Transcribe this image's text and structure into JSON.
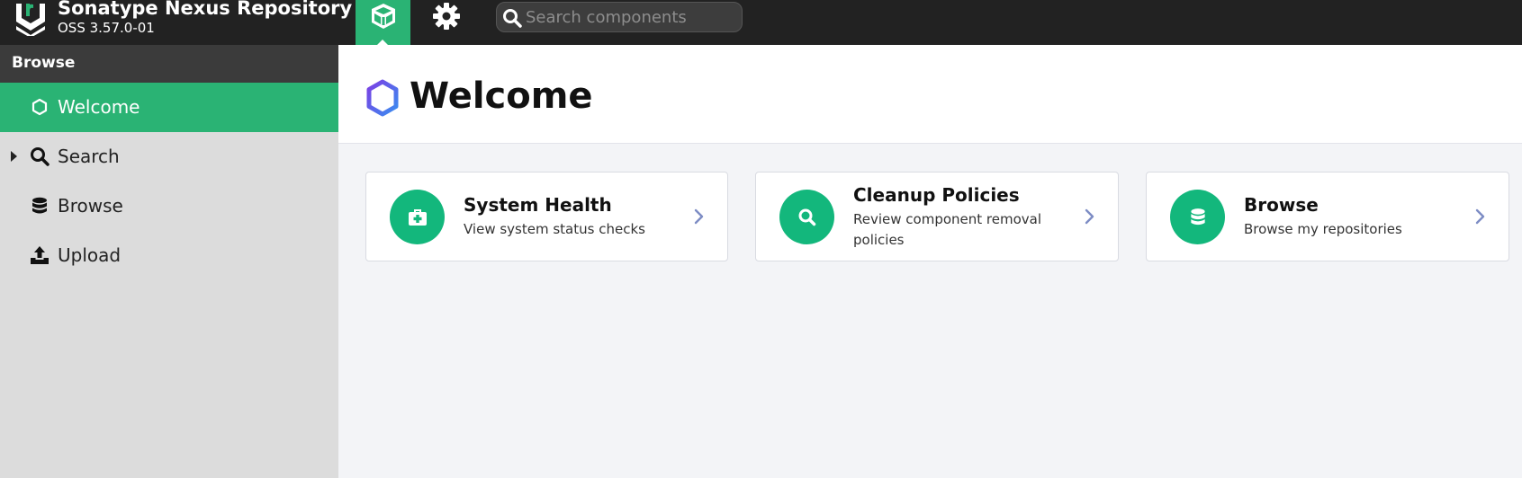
{
  "header": {
    "title": "Sonatype Nexus Repository",
    "version": "OSS 3.57.0-01",
    "search_placeholder": "Search components"
  },
  "sidebar": {
    "heading": "Browse",
    "items": [
      {
        "label": "Welcome",
        "icon": "hexagon-icon",
        "active": true
      },
      {
        "label": "Search",
        "icon": "search-icon",
        "expandable": true
      },
      {
        "label": "Browse",
        "icon": "database-icon"
      },
      {
        "label": "Upload",
        "icon": "upload-icon"
      }
    ]
  },
  "main": {
    "title": "Welcome",
    "cards": [
      {
        "title": "System Health",
        "description": "View system status checks",
        "icon": "first-aid-kit-icon"
      },
      {
        "title": "Cleanup Policies",
        "description": "Review component removal policies",
        "icon": "search-icon"
      },
      {
        "title": "Browse",
        "description": "Browse my repositories",
        "icon": "database-icon"
      }
    ]
  },
  "colors": {
    "header_bg": "#222222",
    "accent_green": "#2ab374",
    "card_icon_green": "#13b77c",
    "sidebar_bg": "#dcdcdc",
    "content_bg": "#f3f4f7",
    "chevron": "#7d8cc4"
  }
}
